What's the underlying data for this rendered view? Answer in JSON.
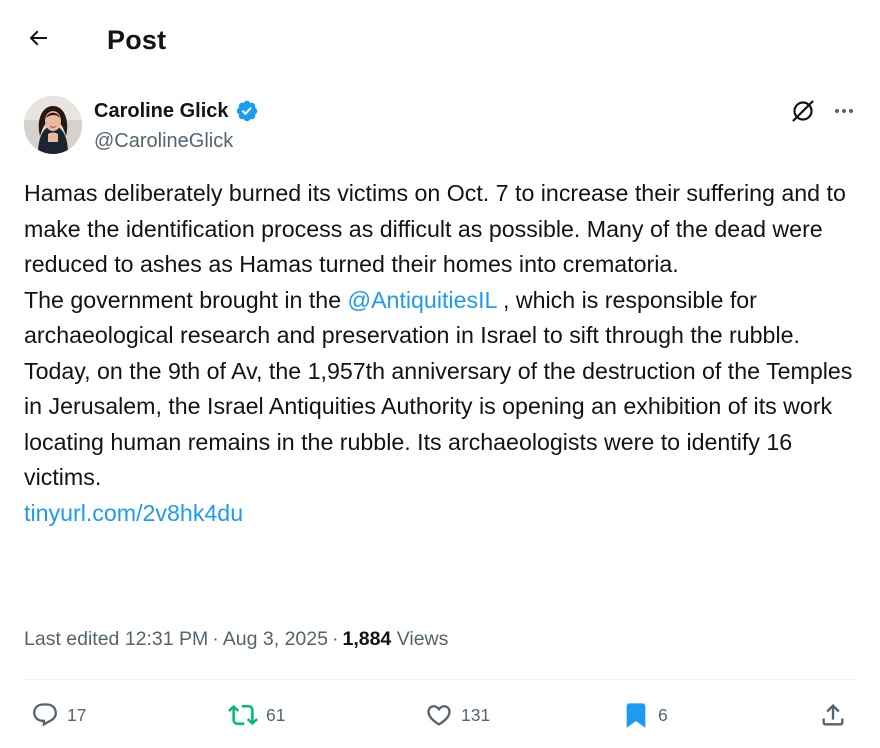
{
  "header": {
    "back_icon": "arrow-left-icon",
    "title": "Post"
  },
  "author": {
    "name": "Caroline Glick",
    "handle": "@CarolineGlick",
    "verified_icon": "verified-badge-icon",
    "verified_color": "#1d9bf0"
  },
  "top_actions": {
    "grok_icon": "grok-icon",
    "more_icon": "more-horizontal-icon"
  },
  "tweet": {
    "paragraph1": "Hamas deliberately burned its victims on Oct. 7 to increase their suffering and to make the identification process as difficult as possible. Many of the dead were reduced to ashes as Hamas turned their homes into crematoria.",
    "paragraph2_before": "The government brought in the ",
    "mention": "@AntiquitiesIL",
    "paragraph2_after": " , which is responsible for archaeological research and preservation in Israel to sift through the rubble.",
    "paragraph3": "Today, on the 9th of Av, the 1,957th anniversary of the destruction of the Temples in Jerusalem, the Israel Antiquities Authority is opening an exhibition of its work locating human remains in the rubble. Its archaeologists were to identify 16 victims.",
    "link": "tinyurl.com/2v8hk4du",
    "link_color": "#1d9bf0"
  },
  "meta": {
    "edited_label": "Last edited",
    "time": "12:31 PM",
    "separator": "·",
    "date": "Aug 3, 2025",
    "views_count": "1,884",
    "views_label": "Views"
  },
  "actions": {
    "replies": "17",
    "reposts": "61",
    "likes": "131",
    "bookmarks": "6",
    "reply_icon": "reply-icon",
    "repost_icon": "repost-icon",
    "like_icon": "heart-icon",
    "bookmark_icon": "bookmark-icon",
    "share_icon": "share-icon",
    "repost_color": "#00ba7c",
    "bookmark_color": "#1d9bf0"
  }
}
